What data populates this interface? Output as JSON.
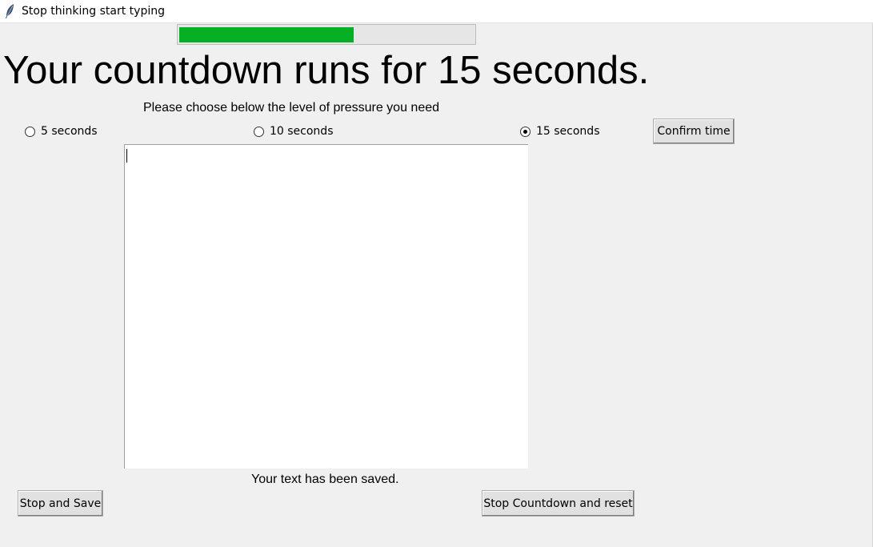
{
  "window": {
    "title": "Stop thinking start typing",
    "icon": "feather-icon"
  },
  "progress": {
    "fraction": 0.59,
    "color": "#06b025"
  },
  "heading": "Your countdown runs for 15 seconds.",
  "subheading": "Please choose below the level of pressure you need",
  "radios": [
    {
      "label": "5 seconds",
      "selected": false
    },
    {
      "label": "10 seconds",
      "selected": false
    },
    {
      "label": "15 seconds",
      "selected": true
    }
  ],
  "buttons": {
    "confirm": "Confirm time",
    "stop_save": "Stop and Save",
    "stop_reset": "Stop Countdown and reset"
  },
  "editor": {
    "value": ""
  },
  "status": "Your text has been saved."
}
